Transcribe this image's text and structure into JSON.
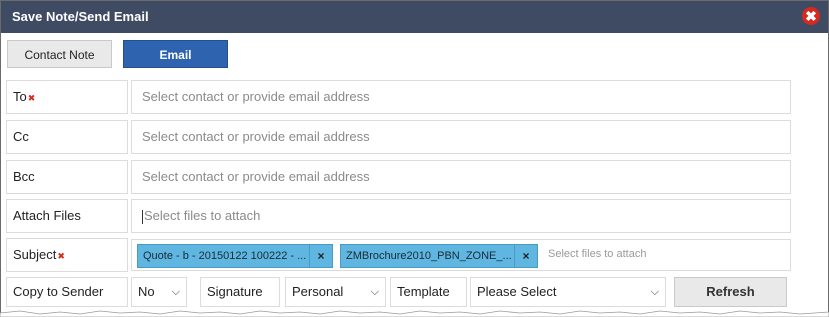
{
  "dialog": {
    "title": "Save Note/Send Email",
    "close_glyph": "✖"
  },
  "tabs": [
    {
      "label": "Contact Note"
    },
    {
      "label": "Email"
    }
  ],
  "fields": {
    "to": {
      "label": "To",
      "placeholder": "Select contact or provide email address"
    },
    "cc": {
      "label": "Cc",
      "placeholder": "Select contact or provide email address"
    },
    "bcc": {
      "label": "Bcc",
      "placeholder": "Select contact or provide email address"
    },
    "attach": {
      "label": "Attach Files",
      "placeholder": "Select files to attach"
    },
    "subject": {
      "label": "Subject",
      "placeholder": "Select files to attach"
    }
  },
  "attachments": [
    {
      "name": "Quote - b - 20150122 100222 - ..."
    },
    {
      "name": "ZMBrochure2010_PBN_ZONE_..."
    }
  ],
  "chip_remove_glyph": "×",
  "required_glyph": "✖",
  "bottom": {
    "copy_label": "Copy to Sender",
    "copy_value": "No",
    "signature_label": "Signature",
    "signature_value": "Personal",
    "template_label": "Template",
    "template_value": "Please Select",
    "refresh_label": "Refresh"
  },
  "colors": {
    "titlebar": "#3f4a63",
    "email_tab": "#2e63b0",
    "chip": "#5fb6e0",
    "required": "#d42a1f"
  }
}
